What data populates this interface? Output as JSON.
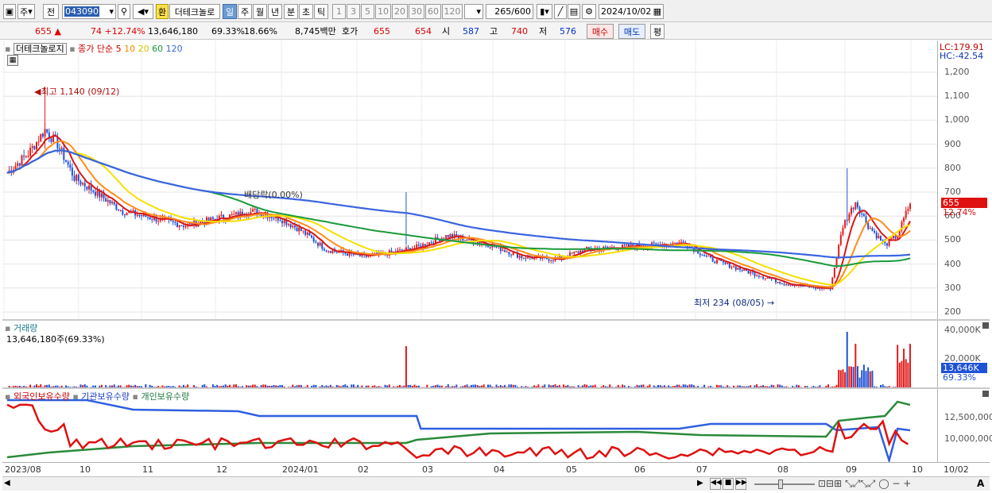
{
  "toolbar": {
    "period_week": "주",
    "prev": "전",
    "stock_code": "043090",
    "exchange_mark": "환",
    "stock_name": "더테크놀로",
    "period_day": "일",
    "period_week2": "주",
    "period_month": "월",
    "period_year": "년",
    "period_min": "분",
    "period_sec": "초",
    "period_tick": "틱",
    "intervals": [
      "1",
      "3",
      "5",
      "10",
      "20",
      "30",
      "60",
      "120"
    ],
    "count_current": "265",
    "count_max": "/600",
    "date": "2024/10/02"
  },
  "quote": {
    "price": "655",
    "change": "74",
    "change_pct": "+12.74%",
    "volume": "13,646,180",
    "vol_ratio": "69.33%",
    "turnover": "18.66%",
    "amount": "8,745백만",
    "ask_label": "호가",
    "ask1": "655",
    "bid1": "654",
    "open_label": "시",
    "open": "587",
    "high_label": "고",
    "high": "740",
    "low_label": "저",
    "low": "576",
    "buy_btn": "매수",
    "sell_btn": "매도",
    "eval_btn": "평"
  },
  "price_panel": {
    "title": "더테크놀로지",
    "ma_label": "종가 단순",
    "ma_periods": [
      "5",
      "10",
      "20",
      "60",
      "120"
    ],
    "lc": "LC:179.91",
    "hc": "HC:-42.54",
    "high_annot": "최고 1,140 (09/12)",
    "low_annot": "최저 234 (08/05)",
    "dividend_annot": "배당락(0.00%)",
    "price_tag": "655",
    "pct_tag": "12.74%",
    "y_ticks": [
      "1,200",
      "1,100",
      "1,000",
      "900",
      "800",
      "700",
      "600",
      "500",
      "400",
      "300",
      "200"
    ]
  },
  "volume_panel": {
    "title": "거래량",
    "info": "13,646,180주(69.33%)",
    "y_ticks": [
      "40,000K",
      "20,000K"
    ],
    "vol_tag": "13,646K",
    "pct_tag": "69.33%"
  },
  "holdings_panel": {
    "foreign": "외국인보유수량",
    "inst": "기관보유수량",
    "indiv": "개인보유수량",
    "y_ticks": [
      "12,500,000",
      "10,000,000"
    ]
  },
  "xaxis": {
    "labels": [
      "2023/08",
      "10",
      "11",
      "12",
      "2024/01",
      "02",
      "03",
      "04",
      "05",
      "06",
      "07",
      "08",
      "09",
      "10"
    ],
    "right_label": "10/02"
  },
  "colors": {
    "ma5": "#d81818",
    "ma10": "#ff8c1a",
    "ma20": "#f5e000",
    "ma60": "#1a9a3a",
    "ma120": "#3a64e0",
    "up": "#e31a1a",
    "down": "#1f52d6"
  }
}
